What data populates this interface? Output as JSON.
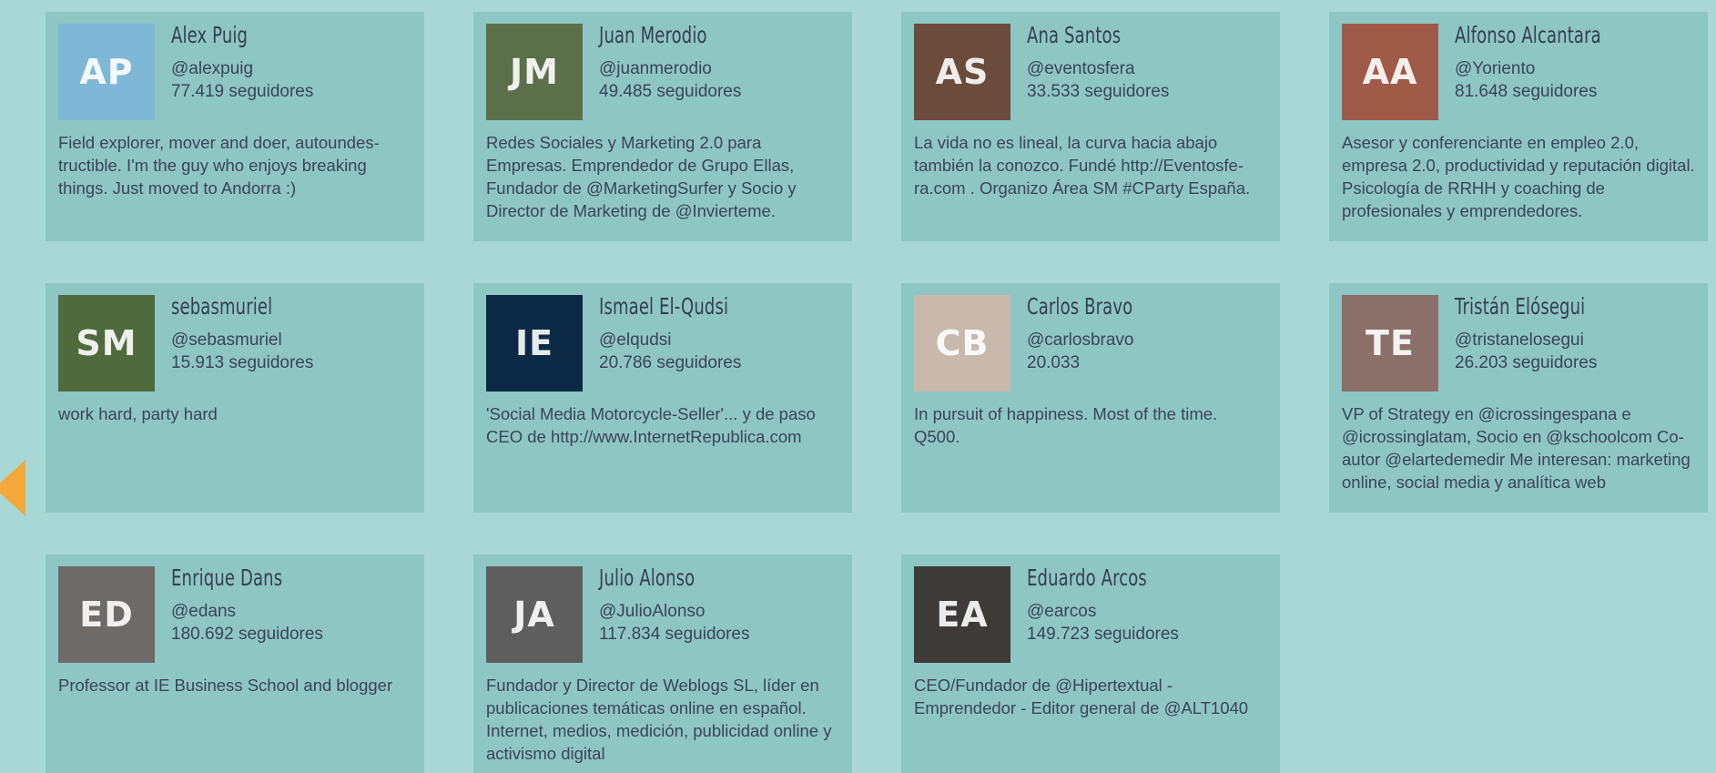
{
  "nav": {
    "prev_label": "previous"
  },
  "cards": [
    {
      "name": "Alex Puig",
      "handle": "@alexpuig",
      "followers": "77.419 seguidores",
      "bio": "Field explorer, mover and doer, autoundes-tructible. I'm the guy who enjoys breaking things. Just moved to Andorra :)",
      "avatar_color": "#7fb7d6",
      "avatar_initials": "AP"
    },
    {
      "name": "Juan Merodio",
      "handle": "@juanmerodio",
      "followers": "49.485 seguidores",
      "bio": "Redes Sociales y Marketing 2.0 para Empresas. Emprendedor de Grupo Ellas, Fundador de @MarketingSurfer y Socio y Director de Marketing de @Invierteme.",
      "avatar_color": "#5a6f4a",
      "avatar_initials": "JM"
    },
    {
      "name": "Ana Santos",
      "handle": "@eventosfera",
      "followers": "33.533 seguidores",
      "bio": "La vida no es lineal, la curva hacia abajo también la conozco. Fundé http://Eventosfe-ra.com . Organizo Área SM #CParty España.",
      "avatar_color": "#6b4b3a",
      "avatar_initials": "AS"
    },
    {
      "name": "Alfonso Alcantara",
      "handle": "@Yoriento",
      "followers": "81.648 seguidores",
      "bio": "Asesor y conferenciante en empleo 2.0, empresa 2.0, productividad y reputación digital. Psicología de RRHH y coaching de profesionales y emprendedores.",
      "avatar_color": "#a05a48",
      "avatar_initials": "AA"
    },
    {
      "name": "sebasmuriel",
      "handle": "@sebasmuriel",
      "followers": "15.913 seguidores",
      "bio": "work hard, party hard",
      "avatar_color": "#4f6a3c",
      "avatar_initials": "SM"
    },
    {
      "name": "Ismael El-Qudsi",
      "handle": "@elqudsi",
      "followers": "20.786 seguidores",
      "bio": "'Social Media Motorcycle-Seller'... y de paso CEO de http://www.InternetRepublica.com",
      "avatar_color": "#0c2a45",
      "avatar_initials": "IE"
    },
    {
      "name": "Carlos Bravo",
      "handle": "@carlosbravo",
      "followers": "20.033",
      "bio": "In pursuit of happiness. Most of the time. Q500.",
      "avatar_color": "#c9b9ad",
      "avatar_initials": "CB"
    },
    {
      "name": "Tristán Elósegui",
      "handle": "@tristanelosegui",
      "followers": "26.203 seguidores",
      "bio": "VP of Strategy en @icrossingespana e @icrossinglatam, Socio en @kschoolcom Co-autor @elartedemedir Me interesan: marketing online, social media y analítica web",
      "avatar_color": "#8a7068",
      "avatar_initials": "TE"
    },
    {
      "name": "Enrique Dans",
      "handle": "@edans",
      "followers": "180.692 seguidores",
      "bio": "Professor at IE Business School and blogger",
      "avatar_color": "#6d6a68",
      "avatar_initials": "ED"
    },
    {
      "name": "Julio Alonso",
      "handle": "@JulioAlonso",
      "followers": "117.834 seguidores",
      "bio": "Fundador y Director de Weblogs SL, líder en publicaciones temáticas online en español. Internet, medios, medición, publicidad online y activismo digital",
      "avatar_color": "#5e5e5e",
      "avatar_initials": "JA"
    },
    {
      "name": "Eduardo Arcos",
      "handle": "@earcos",
      "followers": "149.723 seguidores",
      "bio": "CEO/Fundador de @Hipertextual - Emprendedor - Editor general de @ALT1040",
      "avatar_color": "#3d3a37",
      "avatar_initials": "EA"
    }
  ]
}
